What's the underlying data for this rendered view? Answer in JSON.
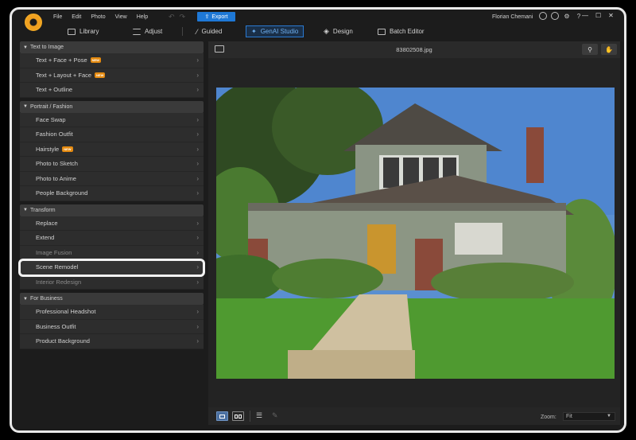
{
  "menu": [
    "File",
    "Edit",
    "Photo",
    "View",
    "Help"
  ],
  "export_label": "Export",
  "user_name": "Florian Chemani",
  "modes": [
    {
      "label": "Library",
      "icon": "library-icon"
    },
    {
      "label": "Adjust",
      "icon": "sliders-icon"
    },
    {
      "label": "Guided",
      "icon": "wand-icon"
    },
    {
      "label": "GenAI Studio",
      "icon": "sparkle-icon",
      "active": true
    },
    {
      "label": "Design",
      "icon": "layers-icon"
    },
    {
      "label": "Batch Editor",
      "icon": "batch-icon"
    }
  ],
  "sidebar": {
    "groups": [
      {
        "title": "Text to Image",
        "items": [
          {
            "label": "Text + Face + Pose",
            "new": true
          },
          {
            "label": "Text + Layout + Face",
            "new": true
          },
          {
            "label": "Text + Outline"
          }
        ]
      },
      {
        "title": "Portrait / Fashion",
        "items": [
          {
            "label": "Face Swap"
          },
          {
            "label": "Fashion Outfit"
          },
          {
            "label": "Hairstyle",
            "new": true
          },
          {
            "label": "Photo to Sketch"
          },
          {
            "label": "Photo to Anime"
          },
          {
            "label": "People Background"
          }
        ]
      },
      {
        "title": "Transform",
        "items": [
          {
            "label": "Replace"
          },
          {
            "label": "Extend"
          },
          {
            "label": "Image Fusion",
            "dim": true
          },
          {
            "label": "Scene Remodel",
            "selected": true
          },
          {
            "label": "Interior Redesign",
            "dim": true
          }
        ]
      },
      {
        "title": "For Business",
        "items": [
          {
            "label": "Professional Headshot"
          },
          {
            "label": "Business Outfit"
          },
          {
            "label": "Product Background"
          }
        ]
      }
    ],
    "new_badge": "NEW"
  },
  "content": {
    "filename": "83802508.jpg",
    "zoom_label": "Zoom:",
    "zoom_value": "Fit"
  },
  "colors": {
    "accent": "#1e78d6",
    "badge": "#e48a10",
    "bg": "#1c1c1c"
  }
}
